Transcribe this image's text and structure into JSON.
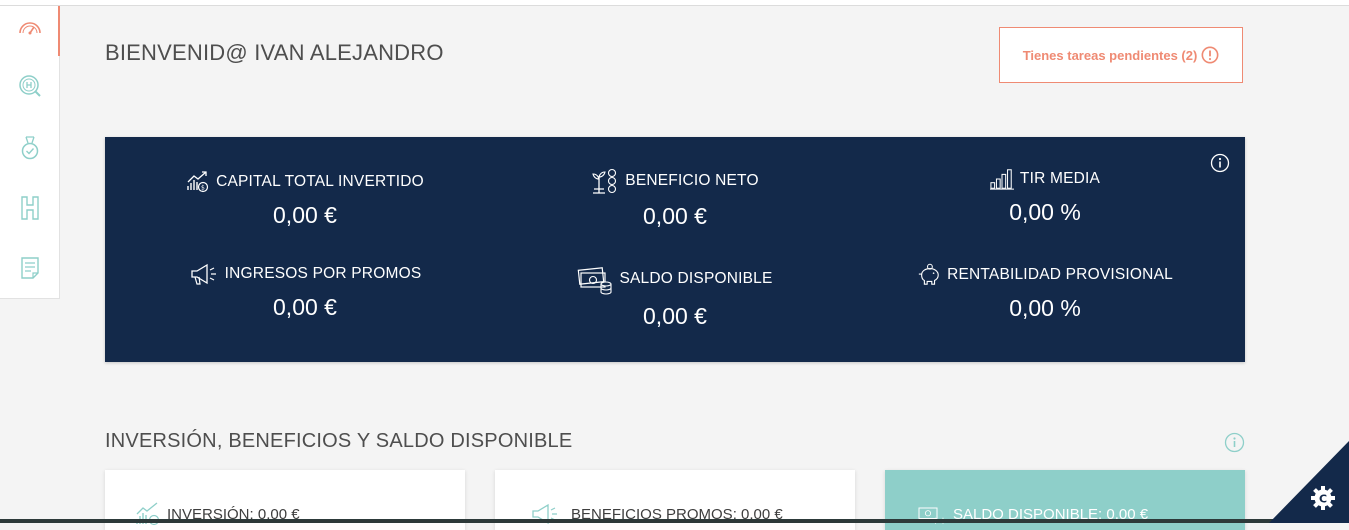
{
  "sidebar": {
    "items": [
      {
        "icon": "speedometer-icon",
        "active": true
      },
      {
        "icon": "search-h-icon",
        "active": false
      },
      {
        "icon": "medal-check-icon",
        "active": false
      },
      {
        "icon": "h-letter-icon",
        "active": false
      },
      {
        "icon": "document-list-icon",
        "active": false
      }
    ]
  },
  "header": {
    "welcome": "BIENVENID@ IVAN ALEJANDRO",
    "tasks_label": "Tienes tareas pendientes (2)"
  },
  "stats": {
    "items": [
      {
        "icon": "capital-chart-icon",
        "label": "CAPITAL TOTAL INVERTIDO",
        "value": "0,00 €"
      },
      {
        "icon": "plant-coins-icon",
        "label": "BENEFICIO NETO",
        "value": "0,00 €"
      },
      {
        "icon": "bar-chart-icon",
        "label": "TIR MEDIA",
        "value": "0,00 %"
      },
      {
        "icon": "megaphone-icon",
        "label": "INGRESOS POR PROMOS",
        "value": "0,00 €"
      },
      {
        "icon": "money-coins-icon",
        "label": "SALDO DISPONIBLE",
        "value": "0,00 €"
      },
      {
        "icon": "piggy-bank-icon",
        "label": "RENTABILIDAD PROVISIONAL",
        "value": "0,00 %"
      }
    ]
  },
  "section": {
    "title": "INVERSIÓN, BENEFICIOS Y SALDO DISPONIBLE",
    "cards": [
      {
        "icon": "capital-chart-icon",
        "label": "INVERSIÓN: 0,00 €"
      },
      {
        "icon": "megaphone-icon",
        "label": "BENEFICIOS PROMOS: 0,00 €"
      },
      {
        "icon": "money-coins-icon",
        "label": "SALDO DISPONIBLE: 0,00 €"
      }
    ]
  },
  "colors": {
    "accent": "#ef8a73",
    "panel": "#13294a",
    "teal": "#8ecfc9",
    "background": "#f4f4f4"
  }
}
